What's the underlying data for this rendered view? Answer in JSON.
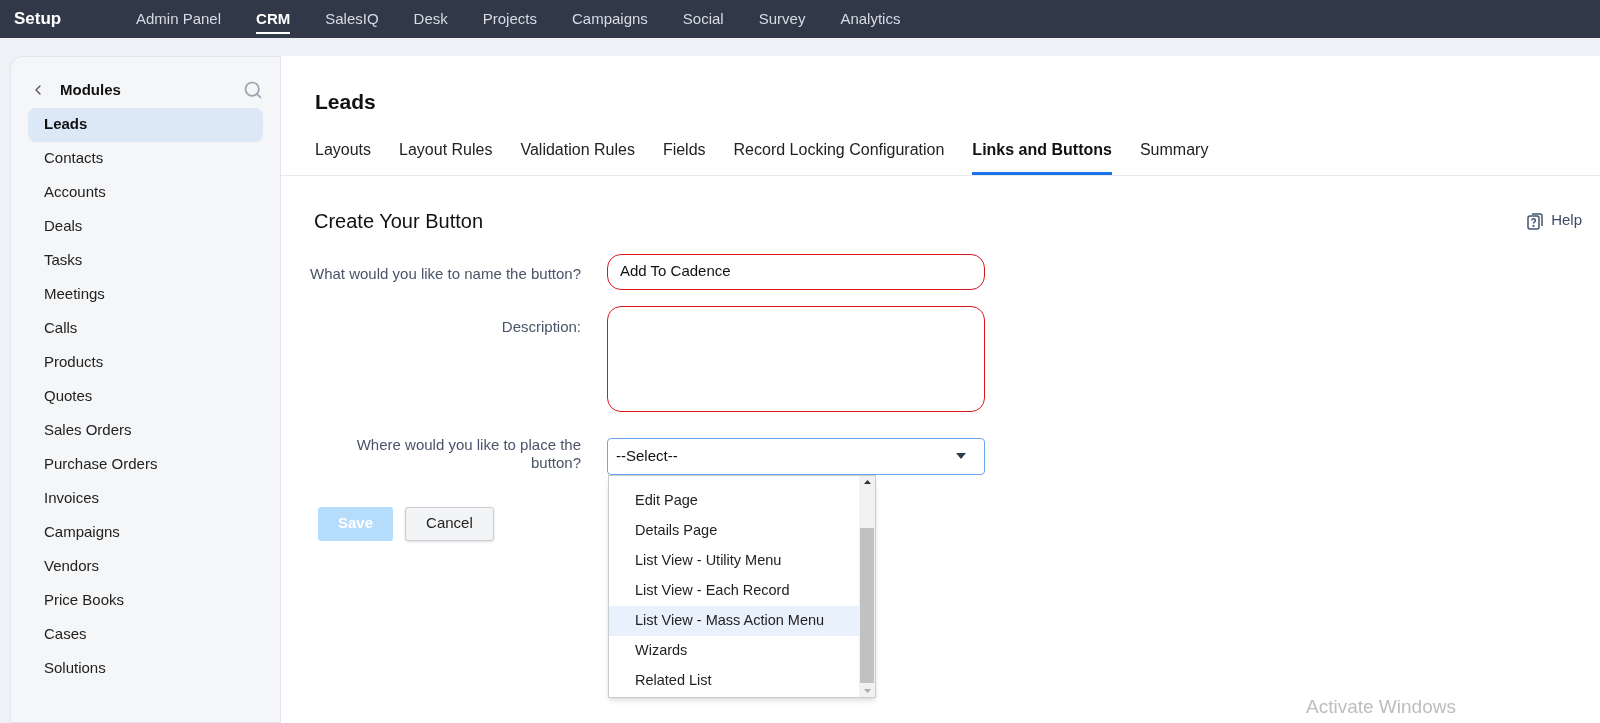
{
  "top_nav": {
    "title": "Setup",
    "items": [
      {
        "label": "Admin Panel",
        "selected": false
      },
      {
        "label": "CRM",
        "selected": true
      },
      {
        "label": "SalesIQ",
        "selected": false
      },
      {
        "label": "Desk",
        "selected": false
      },
      {
        "label": "Projects",
        "selected": false
      },
      {
        "label": "Campaigns",
        "selected": false
      },
      {
        "label": "Social",
        "selected": false
      },
      {
        "label": "Survey",
        "selected": false
      },
      {
        "label": "Analytics",
        "selected": false
      }
    ]
  },
  "sidebar": {
    "title": "Modules",
    "items": [
      {
        "label": "Leads",
        "selected": true
      },
      {
        "label": "Contacts",
        "selected": false
      },
      {
        "label": "Accounts",
        "selected": false
      },
      {
        "label": "Deals",
        "selected": false
      },
      {
        "label": "Tasks",
        "selected": false
      },
      {
        "label": "Meetings",
        "selected": false
      },
      {
        "label": "Calls",
        "selected": false
      },
      {
        "label": "Products",
        "selected": false
      },
      {
        "label": "Quotes",
        "selected": false
      },
      {
        "label": "Sales Orders",
        "selected": false
      },
      {
        "label": "Purchase Orders",
        "selected": false
      },
      {
        "label": "Invoices",
        "selected": false
      },
      {
        "label": "Campaigns",
        "selected": false
      },
      {
        "label": "Vendors",
        "selected": false
      },
      {
        "label": "Price Books",
        "selected": false
      },
      {
        "label": "Cases",
        "selected": false
      },
      {
        "label": "Solutions",
        "selected": false
      }
    ]
  },
  "page_title": "Leads",
  "tabs": [
    {
      "label": "Layouts",
      "selected": false
    },
    {
      "label": "Layout Rules",
      "selected": false
    },
    {
      "label": "Validation Rules",
      "selected": false
    },
    {
      "label": "Fields",
      "selected": false
    },
    {
      "label": "Record Locking Configuration",
      "selected": false
    },
    {
      "label": "Links and Buttons",
      "selected": true
    },
    {
      "label": "Summary",
      "selected": false
    }
  ],
  "form": {
    "title": "Create Your Button",
    "help": "Help",
    "name_field": {
      "label": "What would you like to name the button?",
      "value": "Add To Cadence",
      "annotated": true
    },
    "description_field": {
      "label": "Description:",
      "annotated": true
    },
    "placement_field": {
      "label": "Where would you like to place the button?",
      "value": "--Select--",
      "options": [
        {
          "label": "Edit Page",
          "selected": false
        },
        {
          "label": "Details Page",
          "selected": false
        },
        {
          "label": "List View - Utility Menu",
          "selected": false
        },
        {
          "label": "List View - Each Record",
          "selected": false
        },
        {
          "label": "List View - Mass Action Menu",
          "selected": true
        },
        {
          "label": "Wizards",
          "selected": false
        },
        {
          "label": "Related List",
          "selected": false
        }
      ]
    },
    "buttons": [
      {
        "label": "Save",
        "kind": "primary",
        "disabled": true
      },
      {
        "label": "Cancel",
        "kind": "secondary",
        "disabled": false
      }
    ]
  },
  "os_notice": "Activate Windows"
}
